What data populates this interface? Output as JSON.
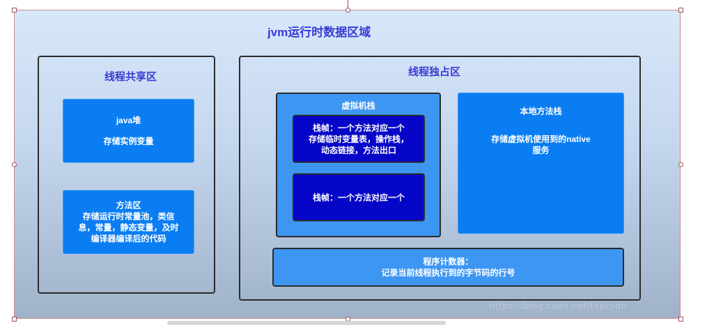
{
  "diagram": {
    "title": "jvm运行时数据区域",
    "shared_area": {
      "title": "线程共享区",
      "heap": {
        "title": "java堆",
        "desc": "存储实例变量"
      },
      "method_area": {
        "text": "方法区\n存储运行时常量池，类信\n息，常量，静态变量，及时\n编译器编译后的代码"
      }
    },
    "private_area": {
      "title": "线程独占区",
      "vm_stack": {
        "title": "虚拟机栈",
        "frame1": "栈帧：一个方法对应一个\n存储临时变量表，操作栈，\n动态链接，方法出口",
        "frame2": "栈帧：一个方法对应一个"
      },
      "native_stack": {
        "title": "本地方法栈",
        "desc": "存储虚拟机使用到的native\n服务"
      },
      "pc_register": {
        "text": "程序计数器：\n记录当前线程执行到的字节码的行号"
      }
    }
  },
  "watermark": "https://blog.csdn.net/fxkcsdn"
}
